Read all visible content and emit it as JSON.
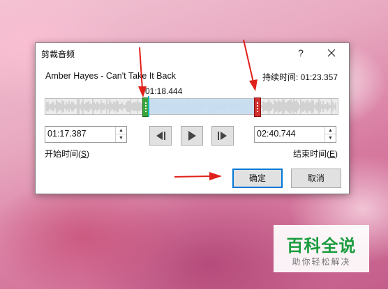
{
  "dialog": {
    "title": "剪裁音频",
    "help_label": "?",
    "song_title": "Amber Hayes - Can't Take It Back",
    "duration_text": "持续时间: 01:23.357",
    "playhead_time": "01:18.444",
    "start_time": {
      "value": "01:17.387",
      "label": "开始时间(",
      "label_key": "S",
      "label_end": ")"
    },
    "end_time": {
      "value": "02:40.744",
      "label": "结束时间(",
      "label_key": "E",
      "label_end": ")"
    },
    "buttons": {
      "ok": "确定",
      "cancel": "取消"
    }
  },
  "colors": {
    "selection": "#c7dff3",
    "start_handle": "#3aa53a",
    "end_handle": "#d13030",
    "playhead": "#17b7b7",
    "annotation_arrow": "#e0201a"
  },
  "watermark": {
    "title": "百科全说",
    "subtitle": "助你轻松解决"
  }
}
